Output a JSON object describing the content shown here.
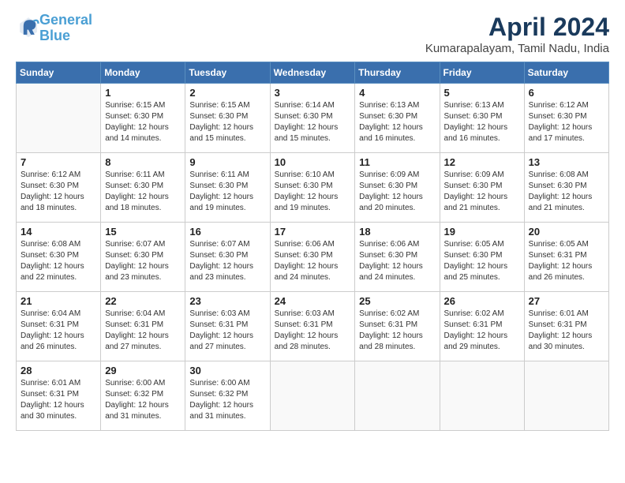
{
  "header": {
    "logo_line1": "General",
    "logo_line2": "Blue",
    "title": "April 2024",
    "subtitle": "Kumarapalayam, Tamil Nadu, India"
  },
  "calendar": {
    "days_of_week": [
      "Sunday",
      "Monday",
      "Tuesday",
      "Wednesday",
      "Thursday",
      "Friday",
      "Saturday"
    ],
    "weeks": [
      [
        {
          "day": "",
          "info": ""
        },
        {
          "day": "1",
          "info": "Sunrise: 6:15 AM\nSunset: 6:30 PM\nDaylight: 12 hours\nand 14 minutes."
        },
        {
          "day": "2",
          "info": "Sunrise: 6:15 AM\nSunset: 6:30 PM\nDaylight: 12 hours\nand 15 minutes."
        },
        {
          "day": "3",
          "info": "Sunrise: 6:14 AM\nSunset: 6:30 PM\nDaylight: 12 hours\nand 15 minutes."
        },
        {
          "day": "4",
          "info": "Sunrise: 6:13 AM\nSunset: 6:30 PM\nDaylight: 12 hours\nand 16 minutes."
        },
        {
          "day": "5",
          "info": "Sunrise: 6:13 AM\nSunset: 6:30 PM\nDaylight: 12 hours\nand 16 minutes."
        },
        {
          "day": "6",
          "info": "Sunrise: 6:12 AM\nSunset: 6:30 PM\nDaylight: 12 hours\nand 17 minutes."
        }
      ],
      [
        {
          "day": "7",
          "info": "Sunrise: 6:12 AM\nSunset: 6:30 PM\nDaylight: 12 hours\nand 18 minutes."
        },
        {
          "day": "8",
          "info": "Sunrise: 6:11 AM\nSunset: 6:30 PM\nDaylight: 12 hours\nand 18 minutes."
        },
        {
          "day": "9",
          "info": "Sunrise: 6:11 AM\nSunset: 6:30 PM\nDaylight: 12 hours\nand 19 minutes."
        },
        {
          "day": "10",
          "info": "Sunrise: 6:10 AM\nSunset: 6:30 PM\nDaylight: 12 hours\nand 19 minutes."
        },
        {
          "day": "11",
          "info": "Sunrise: 6:09 AM\nSunset: 6:30 PM\nDaylight: 12 hours\nand 20 minutes."
        },
        {
          "day": "12",
          "info": "Sunrise: 6:09 AM\nSunset: 6:30 PM\nDaylight: 12 hours\nand 21 minutes."
        },
        {
          "day": "13",
          "info": "Sunrise: 6:08 AM\nSunset: 6:30 PM\nDaylight: 12 hours\nand 21 minutes."
        }
      ],
      [
        {
          "day": "14",
          "info": "Sunrise: 6:08 AM\nSunset: 6:30 PM\nDaylight: 12 hours\nand 22 minutes."
        },
        {
          "day": "15",
          "info": "Sunrise: 6:07 AM\nSunset: 6:30 PM\nDaylight: 12 hours\nand 23 minutes."
        },
        {
          "day": "16",
          "info": "Sunrise: 6:07 AM\nSunset: 6:30 PM\nDaylight: 12 hours\nand 23 minutes."
        },
        {
          "day": "17",
          "info": "Sunrise: 6:06 AM\nSunset: 6:30 PM\nDaylight: 12 hours\nand 24 minutes."
        },
        {
          "day": "18",
          "info": "Sunrise: 6:06 AM\nSunset: 6:30 PM\nDaylight: 12 hours\nand 24 minutes."
        },
        {
          "day": "19",
          "info": "Sunrise: 6:05 AM\nSunset: 6:30 PM\nDaylight: 12 hours\nand 25 minutes."
        },
        {
          "day": "20",
          "info": "Sunrise: 6:05 AM\nSunset: 6:31 PM\nDaylight: 12 hours\nand 26 minutes."
        }
      ],
      [
        {
          "day": "21",
          "info": "Sunrise: 6:04 AM\nSunset: 6:31 PM\nDaylight: 12 hours\nand 26 minutes."
        },
        {
          "day": "22",
          "info": "Sunrise: 6:04 AM\nSunset: 6:31 PM\nDaylight: 12 hours\nand 27 minutes."
        },
        {
          "day": "23",
          "info": "Sunrise: 6:03 AM\nSunset: 6:31 PM\nDaylight: 12 hours\nand 27 minutes."
        },
        {
          "day": "24",
          "info": "Sunrise: 6:03 AM\nSunset: 6:31 PM\nDaylight: 12 hours\nand 28 minutes."
        },
        {
          "day": "25",
          "info": "Sunrise: 6:02 AM\nSunset: 6:31 PM\nDaylight: 12 hours\nand 28 minutes."
        },
        {
          "day": "26",
          "info": "Sunrise: 6:02 AM\nSunset: 6:31 PM\nDaylight: 12 hours\nand 29 minutes."
        },
        {
          "day": "27",
          "info": "Sunrise: 6:01 AM\nSunset: 6:31 PM\nDaylight: 12 hours\nand 30 minutes."
        }
      ],
      [
        {
          "day": "28",
          "info": "Sunrise: 6:01 AM\nSunset: 6:31 PM\nDaylight: 12 hours\nand 30 minutes."
        },
        {
          "day": "29",
          "info": "Sunrise: 6:00 AM\nSunset: 6:32 PM\nDaylight: 12 hours\nand 31 minutes."
        },
        {
          "day": "30",
          "info": "Sunrise: 6:00 AM\nSunset: 6:32 PM\nDaylight: 12 hours\nand 31 minutes."
        },
        {
          "day": "",
          "info": ""
        },
        {
          "day": "",
          "info": ""
        },
        {
          "day": "",
          "info": ""
        },
        {
          "day": "",
          "info": ""
        }
      ]
    ]
  }
}
